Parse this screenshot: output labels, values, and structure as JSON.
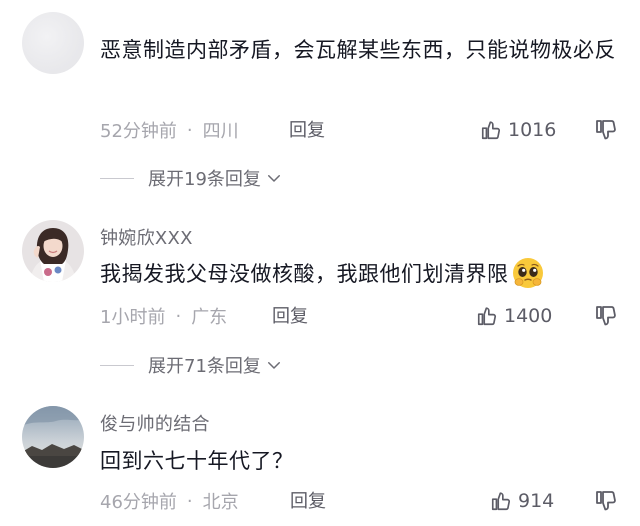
{
  "comments": [
    {
      "username": "",
      "text": "恶意制造内部矛盾，会瓦解某些东西，只能说物极必反",
      "time": "52分钟前",
      "location": "四川",
      "reply_label": "回复",
      "likes": "1016",
      "expand_label": "展开19条回复"
    },
    {
      "username": "钟婉欣XXX",
      "text": "我揭发我父母没做核酸，我跟他们划清界限",
      "emoji": "pleading-face-emoji",
      "time": "1小时前",
      "location": "广东",
      "reply_label": "回复",
      "likes": "1400",
      "expand_label": "展开71条回复"
    },
    {
      "username": "俊与帅的结合",
      "text": "回到六七十年代了？",
      "time": "46分钟前",
      "location": "北京",
      "reply_label": "回复",
      "likes": "914"
    }
  ],
  "separator": "·",
  "icons": {
    "like": "thumbs-up-icon",
    "dislike": "thumbs-down-icon",
    "expand": "chevron-down-icon"
  },
  "colors": {
    "text_primary": "#161823",
    "text_secondary": "#6c6c74",
    "text_meta": "#a6a6ad"
  }
}
